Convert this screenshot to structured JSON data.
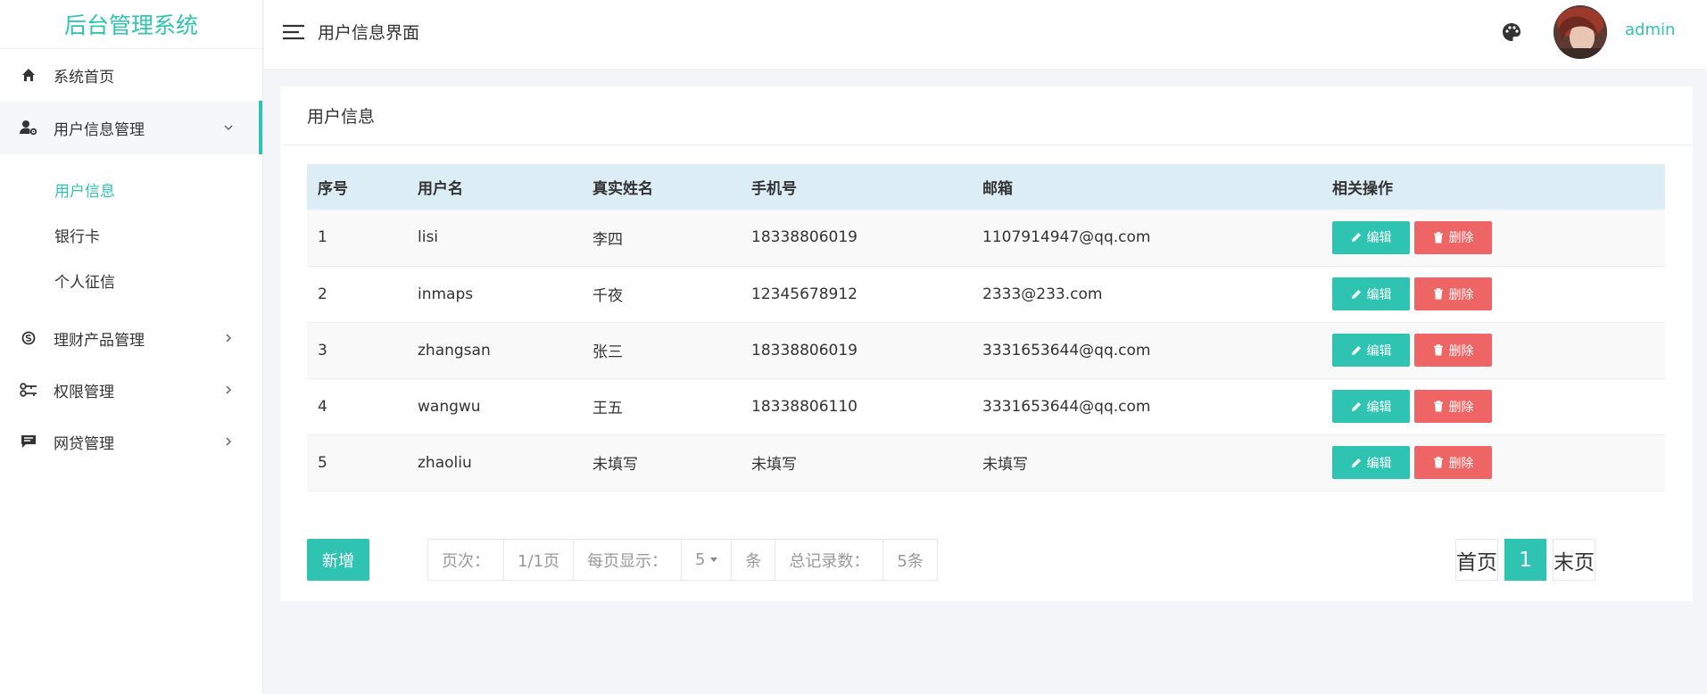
{
  "brand": "后台管理系统",
  "header": {
    "title": "用户信息界面",
    "username": "admin"
  },
  "sidebar": {
    "items": [
      {
        "label": "系统首页",
        "icon": "home-icon"
      },
      {
        "label": "用户信息管理",
        "icon": "user-settings-icon",
        "open": true,
        "children": [
          {
            "label": "用户信息",
            "active": true
          },
          {
            "label": "银行卡"
          },
          {
            "label": "个人征信"
          }
        ]
      },
      {
        "label": "理财产品管理",
        "icon": "skype-icon"
      },
      {
        "label": "权限管理",
        "icon": "key-icon"
      },
      {
        "label": "网贷管理",
        "icon": "comment-icon"
      }
    ]
  },
  "card": {
    "title": "用户信息"
  },
  "table": {
    "headers": [
      "序号",
      "用户名",
      "真实姓名",
      "手机号",
      "邮箱",
      "相关操作"
    ],
    "rows": [
      {
        "no": "1",
        "username": "lisi",
        "realname": "李四",
        "phone": "18338806019",
        "email": "1107914947@qq.com"
      },
      {
        "no": "2",
        "username": "inmaps",
        "realname": "千夜",
        "phone": "12345678912",
        "email": "2333@233.com"
      },
      {
        "no": "3",
        "username": "zhangsan",
        "realname": "张三",
        "phone": "18338806019",
        "email": "3331653644@qq.com"
      },
      {
        "no": "4",
        "username": "wangwu",
        "realname": "王五",
        "phone": "18338806110",
        "email": "3331653644@qq.com"
      },
      {
        "no": "5",
        "username": "zhaoliu",
        "realname": "未填写",
        "phone": "未填写",
        "email": "未填写"
      }
    ],
    "edit_label": "编辑",
    "delete_label": "删除"
  },
  "footer": {
    "add_label": "新增",
    "page_label": "页次：",
    "page_value": "1/1页",
    "per_page_label": "每页显示：",
    "per_page_value": "5",
    "per_page_unit": "条",
    "total_label": "总记录数：",
    "total_value": "5条",
    "first_label": "首页",
    "current_page": "1",
    "last_label": "末页"
  },
  "colors": {
    "accent": "#2fc4b2",
    "danger": "#ef6464",
    "table_header_bg": "#dcedf6"
  }
}
